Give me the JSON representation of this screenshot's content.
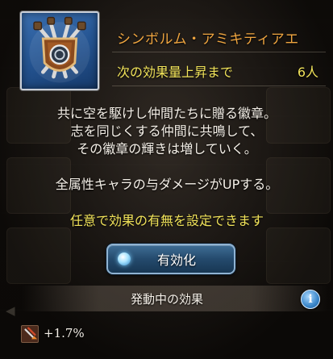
{
  "badge": {
    "emblem_icon": "crossed-swords-shield-emblem",
    "title": "シンボルム・アミキティアエ",
    "next_label": "次の効果量上昇まで",
    "next_count": "6人"
  },
  "description": {
    "lines": [
      "共に空を駆けし仲間たちに贈る徽章。",
      "志を同じくする仲間に共鳴して、",
      "その徽章の輝きは増していく。"
    ],
    "effect": "全属性キャラの与ダメージがUPする。",
    "hint": "任意で効果の有無を設定できます"
  },
  "toggle": {
    "label": "有効化",
    "state": "on"
  },
  "active_effects": {
    "title": "発動中の効果",
    "info_icon": "info-icon",
    "buff_icon": "attack-up-buff-icon",
    "buff_value": "+1.7%"
  },
  "colors": {
    "title": "#f0a640",
    "highlight": "#f1e35a",
    "text": "#f5f0e8",
    "button": "#244a6d"
  }
}
